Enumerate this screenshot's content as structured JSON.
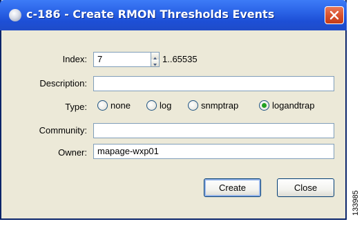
{
  "window": {
    "title": "c-186 - Create RMON Thresholds Events"
  },
  "form": {
    "index_label": "Index:",
    "index_value": "7",
    "index_range": "1..65535",
    "description_label": "Description:",
    "description_value": "",
    "type_label": "Type:",
    "type_options": [
      "none",
      "log",
      "snmptrap",
      "logandtrap"
    ],
    "type_selected": "logandtrap",
    "community_label": "Community:",
    "community_value": "",
    "owner_label": "Owner:",
    "owner_value": "mapage-wxp01"
  },
  "buttons": {
    "create_label": "Create",
    "close_label": "Close"
  },
  "figure_id": "133985",
  "colors": {
    "titlebar": "#2a63e6",
    "dialog_bg": "#ece9d8",
    "close_button": "#d9532f",
    "radio_selected": "#21a121"
  }
}
